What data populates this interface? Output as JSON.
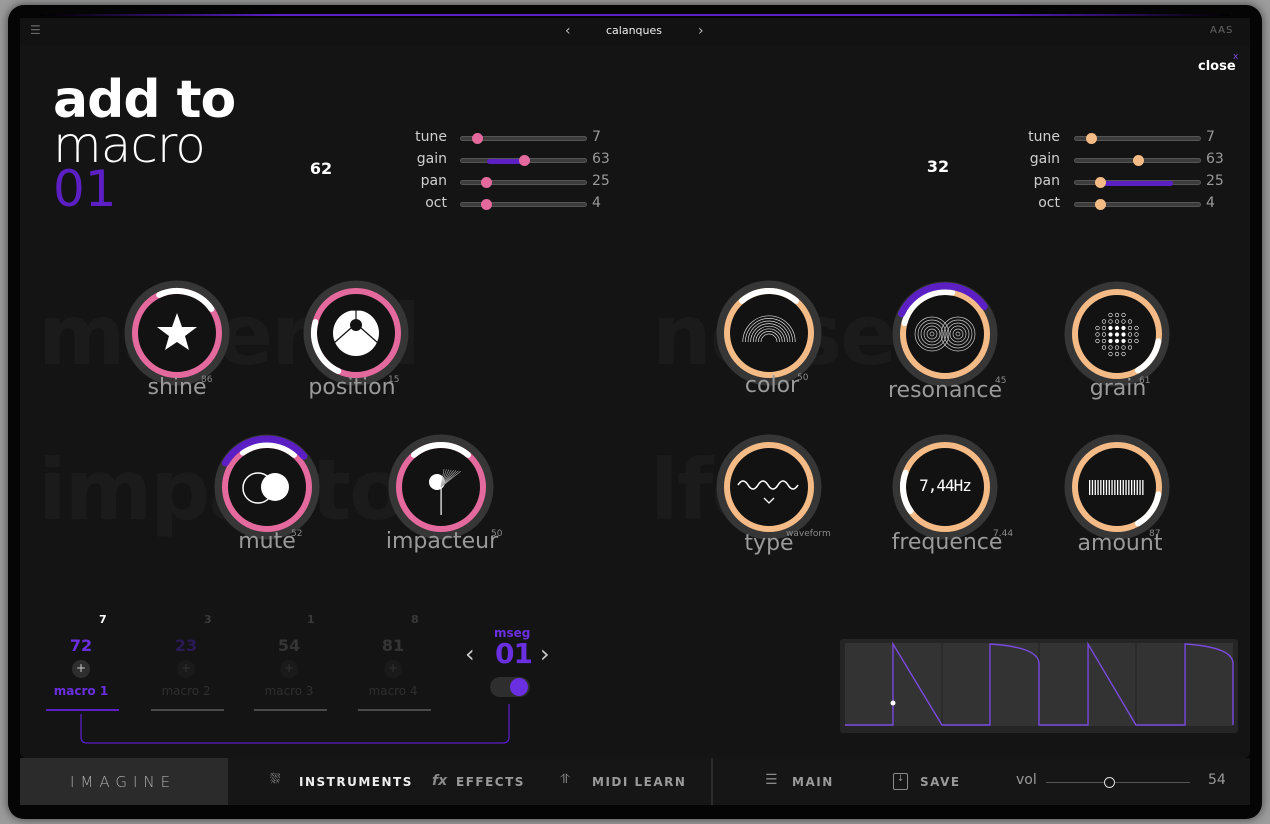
{
  "topbar": {
    "preset_name": "calanques",
    "prev": "‹",
    "next": "›",
    "brand_right": "AAS",
    "menu_icon": "menu-icon"
  },
  "header": {
    "title_line1": "add to",
    "title_line2": "macro",
    "title_number": "01",
    "close_label": "close",
    "close_x": "x"
  },
  "sections": {
    "material": "material",
    "impactor": "impactor",
    "noise": "noise",
    "lfo": "lfo"
  },
  "colors": {
    "pink": "#e46a9e",
    "peach": "#f5bb86",
    "purple": "#5b1fc4",
    "ring": "#3a3a3a"
  },
  "left_layer": {
    "knob_value": "62",
    "sliders": [
      {
        "label": "tune",
        "value": "7",
        "position": 0.13
      },
      {
        "label": "gain",
        "value": "63",
        "position": 0.5,
        "mod_from": 0.21
      },
      {
        "label": "pan",
        "value": "25",
        "position": 0.2
      },
      {
        "label": "oct",
        "value": "4",
        "position": 0.2
      }
    ]
  },
  "right_layer": {
    "knob_value": "32",
    "sliders": [
      {
        "label": "tune",
        "value": "7",
        "position": 0.13
      },
      {
        "label": "gain",
        "value": "63",
        "position": 0.5
      },
      {
        "label": "pan",
        "value": "25",
        "position": 0.2,
        "mod_to": 0.78
      },
      {
        "label": "oct",
        "value": "4",
        "position": 0.2
      }
    ]
  },
  "knobs": [
    {
      "label": "shine",
      "value": "86",
      "icon": "star-icon",
      "color": "pink"
    },
    {
      "label": "position",
      "value": "15",
      "icon": "position-icon",
      "color": "pink"
    },
    {
      "label": "mute",
      "value": "52",
      "icon": "mute-circles-icon",
      "color": "pink",
      "modulated": true
    },
    {
      "label": "impacteur",
      "value": "50",
      "icon": "mallet-icon",
      "color": "pink"
    },
    {
      "label": "color",
      "value": "50",
      "icon": "arcs-icon",
      "color": "peach"
    },
    {
      "label": "resonance",
      "value": "45",
      "icon": "concentric-circles-icon",
      "color": "peach",
      "modulated": true
    },
    {
      "label": "grain",
      "value": "61",
      "icon": "dots-grid-icon",
      "color": "peach"
    },
    {
      "label": "type",
      "value": "waveform",
      "icon": "sine-wave-icon",
      "color": "peach"
    },
    {
      "label": "frequence",
      "value": "7.44",
      "display": "7,44Hz",
      "color": "peach"
    },
    {
      "label": "amount",
      "value": "87",
      "icon": "bars-icon",
      "color": "peach"
    }
  ],
  "macros": [
    {
      "label": "macro 1",
      "value": "72",
      "count": "7",
      "active": true,
      "add": "+"
    },
    {
      "label": "macro 2",
      "value": "23",
      "count": "3",
      "active": false,
      "add": "+"
    },
    {
      "label": "macro 3",
      "value": "54",
      "count": "1",
      "active": false,
      "add": "+"
    },
    {
      "label": "macro 4",
      "value": "81",
      "count": "8",
      "active": false,
      "add": "+"
    }
  ],
  "mseg": {
    "label": "mseg",
    "number": "01",
    "prev": "‹",
    "next": "›",
    "enabled": true
  },
  "bottom": {
    "logo": "IMAGINE",
    "instruments": "INSTRUMENTS",
    "effects": "EFFECTS",
    "fx": "fx",
    "midi_learn": "MIDI LEARN",
    "main": "MAIN",
    "save": "SAVE",
    "vol_label": "vol",
    "vol_value": "54",
    "vol_position": 0.44
  }
}
